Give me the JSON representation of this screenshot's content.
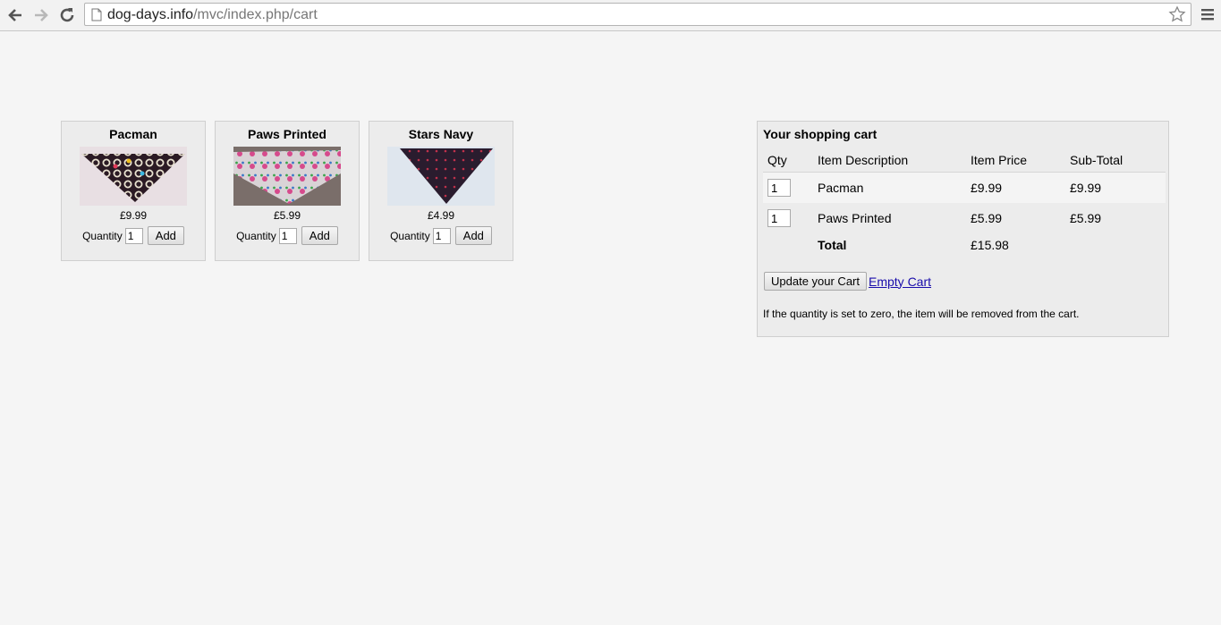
{
  "browser": {
    "url_host": "dog-days.info",
    "url_path": "/mvc/index.php/cart"
  },
  "products": [
    {
      "title": "Pacman",
      "price": "£9.99",
      "quantity_label": "Quantity",
      "quantity_value": "1",
      "add_label": "Add"
    },
    {
      "title": "Paws Printed",
      "price": "£5.99",
      "quantity_label": "Quantity",
      "quantity_value": "1",
      "add_label": "Add"
    },
    {
      "title": "Stars Navy",
      "price": "£4.99",
      "quantity_label": "Quantity",
      "quantity_value": "1",
      "add_label": "Add"
    }
  ],
  "cart": {
    "title": "Your shopping cart",
    "headers": {
      "qty": "Qty",
      "description": "Item Description",
      "price": "Item Price",
      "subtotal": "Sub-Total"
    },
    "rows": [
      {
        "qty": "1",
        "description": "Pacman",
        "price": "£9.99",
        "subtotal": "£9.99"
      },
      {
        "qty": "1",
        "description": "Paws Printed",
        "price": "£5.99",
        "subtotal": "£5.99"
      }
    ],
    "total_label": "Total",
    "total_value": "£15.98",
    "update_label": "Update your Cart",
    "empty_label": "Empty Cart",
    "note": "If the quantity is set to zero, the item will be removed from the cart."
  }
}
